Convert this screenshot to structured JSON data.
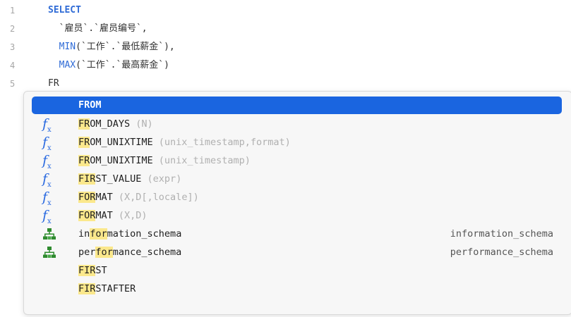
{
  "editor": {
    "lines": [
      {
        "num": "1",
        "parts": [
          {
            "t": "SELECT",
            "c": "kw"
          }
        ]
      },
      {
        "num": "2",
        "parts": [
          {
            "t": "  `雇员`.`雇员编号`,",
            "c": ""
          }
        ]
      },
      {
        "num": "3",
        "parts": [
          {
            "t": "  ",
            "c": ""
          },
          {
            "t": "MIN",
            "c": "fn"
          },
          {
            "t": "(`工作`.`最低薪金`),",
            "c": ""
          }
        ]
      },
      {
        "num": "4",
        "parts": [
          {
            "t": "  ",
            "c": ""
          },
          {
            "t": "MAX",
            "c": "fn"
          },
          {
            "t": "(`工作`.`最高薪金`)",
            "c": ""
          }
        ]
      },
      {
        "num": "5",
        "parts": [
          {
            "t": "FR",
            "c": ""
          }
        ]
      }
    ]
  },
  "autocomplete": {
    "typed_prefix": "FR",
    "items": [
      {
        "icon": "",
        "match": "FROM",
        "rest": "",
        "args": "",
        "right": "",
        "selected": true
      },
      {
        "icon": "function-icon",
        "match": "FR",
        "rest": "OM_DAYS",
        "args": " (N)",
        "right": ""
      },
      {
        "icon": "function-icon",
        "match": "FR",
        "rest": "OM_UNIXTIME",
        "args": " (unix_timestamp,format)",
        "right": ""
      },
      {
        "icon": "function-icon",
        "match": "FR",
        "rest": "OM_UNIXTIME",
        "args": " (unix_timestamp)",
        "right": ""
      },
      {
        "icon": "function-icon",
        "match": "FIR",
        "rest": "ST_VALUE",
        "args": " (expr)",
        "right": ""
      },
      {
        "icon": "function-icon",
        "match": "FOR",
        "rest": "MAT",
        "args": " (X,D[,locale])",
        "right": ""
      },
      {
        "icon": "function-icon",
        "match": "FOR",
        "rest": "MAT",
        "args": " (X,D)",
        "right": ""
      },
      {
        "icon": "schema-icon",
        "pre": "in",
        "match": "for",
        "rest": "mation_schema",
        "args": "",
        "right": "information_schema"
      },
      {
        "icon": "schema-icon",
        "pre": "per",
        "match": "for",
        "rest": "mance_schema",
        "args": "",
        "right": "performance_schema"
      },
      {
        "icon": "",
        "match": "FIR",
        "rest": "ST",
        "args": "",
        "right": ""
      },
      {
        "icon": "",
        "match": "FIR",
        "rest": "STAFTER",
        "args": "",
        "right": ""
      }
    ]
  },
  "colors": {
    "accent": "#1a65e0",
    "highlight": "#fbe88c",
    "keyword": "#2f6bd6",
    "schema_icon": "#2e8b2e"
  }
}
